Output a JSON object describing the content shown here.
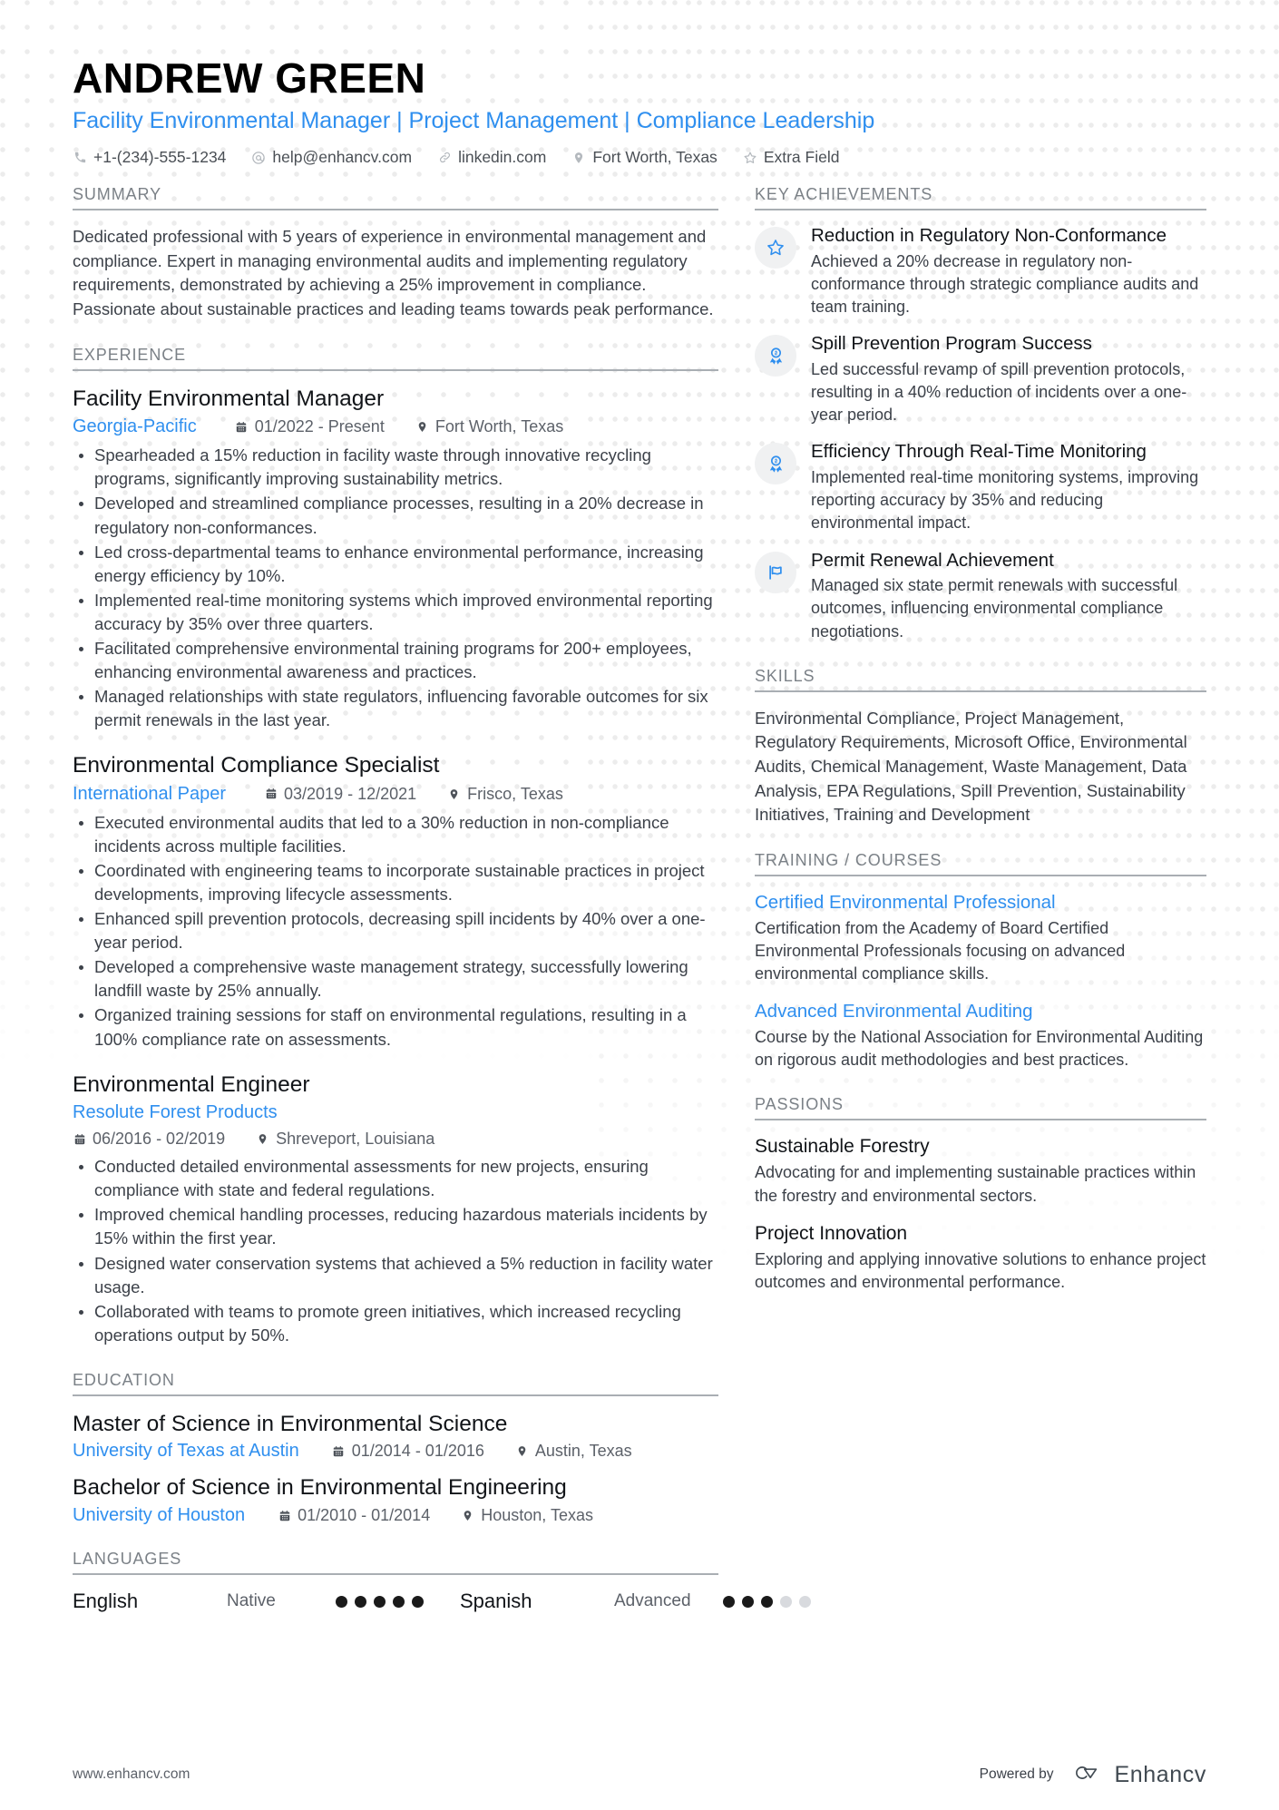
{
  "colors": {
    "accent": "#2f8fef",
    "heading_gray": "#7b8187",
    "body_text": "#3c4149",
    "badge_bg": "#f0f1f2"
  },
  "header": {
    "name": "ANDREW GREEN",
    "headline": "Facility Environmental Manager | Project Management | Compliance Leadership",
    "contacts": [
      {
        "icon": "phone-icon",
        "text": "+1-(234)-555-1234"
      },
      {
        "icon": "email-icon",
        "text": "help@enhancv.com"
      },
      {
        "icon": "link-icon",
        "text": "linkedin.com"
      },
      {
        "icon": "location-pin-icon",
        "text": "Fort Worth, Texas"
      },
      {
        "icon": "star-outline-icon",
        "text": "Extra Field"
      }
    ]
  },
  "summary": {
    "title": "SUMMARY",
    "text": "Dedicated professional with 5 years of experience in environmental management and compliance. Expert in managing environmental audits and implementing regulatory requirements, demonstrated by achieving a 25% improvement in compliance. Passionate about sustainable practices and leading teams towards peak performance."
  },
  "experience": {
    "title": "EXPERIENCE",
    "jobs": [
      {
        "title": "Facility Environmental Manager",
        "company": "Georgia-Pacific",
        "dates": "01/2022 - Present",
        "location": "Fort Worth, Texas",
        "bullets": [
          "Spearheaded a 15% reduction in facility waste through innovative recycling programs, significantly improving sustainability metrics.",
          "Developed and streamlined compliance processes, resulting in a 20% decrease in regulatory non-conformances.",
          "Led cross-departmental teams to enhance environmental performance, increasing energy efficiency by 10%.",
          "Implemented real-time monitoring systems which improved environmental reporting accuracy by 35% over three quarters.",
          "Facilitated comprehensive environmental training programs for 200+ employees, enhancing environmental awareness and practices.",
          "Managed relationships with state regulators, influencing favorable outcomes for six permit renewals in the last year."
        ]
      },
      {
        "title": "Environmental Compliance Specialist",
        "company": "International Paper",
        "dates": "03/2019 - 12/2021",
        "location": "Frisco, Texas",
        "bullets": [
          "Executed environmental audits that led to a 30% reduction in non-compliance incidents across multiple facilities.",
          "Coordinated with engineering teams to incorporate sustainable practices in project developments, improving lifecycle assessments.",
          "Enhanced spill prevention protocols, decreasing spill incidents by 40% over a one-year period.",
          "Developed a comprehensive waste management strategy, successfully lowering landfill waste by 25% annually.",
          "Organized training sessions for staff on environmental regulations, resulting in a 100% compliance rate on assessments."
        ]
      },
      {
        "title": "Environmental Engineer",
        "company": "Resolute Forest Products",
        "dates": "06/2016 - 02/2019",
        "location": "Shreveport, Louisiana",
        "bullets": [
          "Conducted detailed environmental assessments for new projects, ensuring compliance with state and federal regulations.",
          "Improved chemical handling processes, reducing hazardous materials incidents by 15% within the first year.",
          "Designed water conservation systems that achieved a 5% reduction in facility water usage.",
          "Collaborated with teams to promote green initiatives, which increased recycling operations output by 50%."
        ]
      }
    ]
  },
  "education": {
    "title": "EDUCATION",
    "items": [
      {
        "degree": "Master of Science in Environmental Science",
        "school": "University of Texas at Austin",
        "dates": "01/2014 - 01/2016",
        "location": "Austin, Texas"
      },
      {
        "degree": "Bachelor of Science in Environmental Engineering",
        "school": "University of Houston",
        "dates": "01/2010 - 01/2014",
        "location": "Houston, Texas"
      }
    ]
  },
  "languages": {
    "title": "LANGUAGES",
    "items": [
      {
        "name": "English",
        "level": "Native",
        "filled": 5,
        "total": 5
      },
      {
        "name": "Spanish",
        "level": "Advanced",
        "filled": 3,
        "total": 5
      }
    ]
  },
  "key_achievements": {
    "title": "KEY ACHIEVEMENTS",
    "items": [
      {
        "icon": "star-outline-icon",
        "title": "Reduction in Regulatory Non-Conformance",
        "desc": "Achieved a 20% decrease in regulatory non-conformance through strategic compliance audits and team training."
      },
      {
        "icon": "award-ribbon-icon",
        "title": "Spill Prevention Program Success",
        "desc": "Led successful revamp of spill prevention protocols, resulting in a 40% reduction of incidents over a one-year period."
      },
      {
        "icon": "award-ribbon-icon",
        "title": "Efficiency Through Real-Time Monitoring",
        "desc": "Implemented real-time monitoring systems, improving reporting accuracy by 35% and reducing environmental impact."
      },
      {
        "icon": "flag-icon",
        "title": "Permit Renewal Achievement",
        "desc": "Managed six state permit renewals with successful outcomes, influencing environmental compliance negotiations."
      }
    ]
  },
  "skills": {
    "title": "SKILLS",
    "text": "Environmental Compliance, Project Management, Regulatory Requirements, Microsoft Office, Environmental Audits, Chemical Management, Waste Management, Data Analysis, EPA Regulations, Spill Prevention, Sustainability Initiatives, Training and Development"
  },
  "training": {
    "title": "TRAINING / COURSES",
    "items": [
      {
        "title": "Certified Environmental Professional",
        "desc": "Certification from the Academy of Board Certified Environmental Professionals focusing on advanced environmental compliance skills."
      },
      {
        "title": "Advanced Environmental Auditing",
        "desc": "Course by the National Association for Environmental Auditing on rigorous audit methodologies and best practices."
      }
    ]
  },
  "passions": {
    "title": "PASSIONS",
    "items": [
      {
        "title": "Sustainable Forestry",
        "desc": "Advocating for and implementing sustainable practices within the forestry and environmental sectors."
      },
      {
        "title": "Project Innovation",
        "desc": "Exploring and applying innovative solutions to enhance project outcomes and environmental performance."
      }
    ]
  },
  "footer": {
    "url": "www.enhancv.com",
    "powered_by": "Powered by",
    "brand": "Enhancv"
  }
}
